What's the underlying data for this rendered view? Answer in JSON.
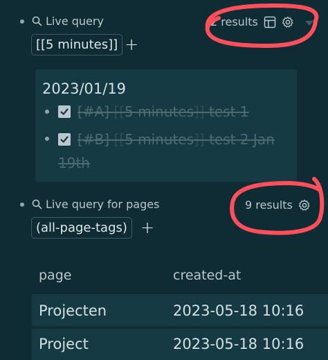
{
  "query1": {
    "label": "Live query",
    "results": "2 results",
    "chip": "[[5 minutes]]",
    "add": "+",
    "group_date": "2023/01/19",
    "tasks": [
      {
        "tag": "[#A]",
        "open": "[[",
        "link": "5 minutes",
        "close": "]]",
        "text": "test 1"
      },
      {
        "tag": "[#B]",
        "open": "[[",
        "link": "5 minutes",
        "close": "]]",
        "text": "test 2 Jan 19th"
      }
    ]
  },
  "query2": {
    "label": "Live query for pages",
    "results": "9 results",
    "chip": "(all-page-tags)",
    "add": "+",
    "columns": [
      "page",
      "created-at"
    ],
    "rows": [
      {
        "page": "Projecten",
        "created_at": "2023-05-18 10:16"
      },
      {
        "page": "Project",
        "created_at": "2023-05-18 10:16"
      }
    ]
  },
  "icons": {
    "search": "search-icon",
    "table": "table-view-icon",
    "settings": "gear-icon",
    "collapse": "caret-down-icon",
    "checkbox": "checkbox-checked-icon"
  },
  "colors": {
    "background": "#0f2b33",
    "panel": "#163a44",
    "annotation": "#ff4f5a"
  }
}
